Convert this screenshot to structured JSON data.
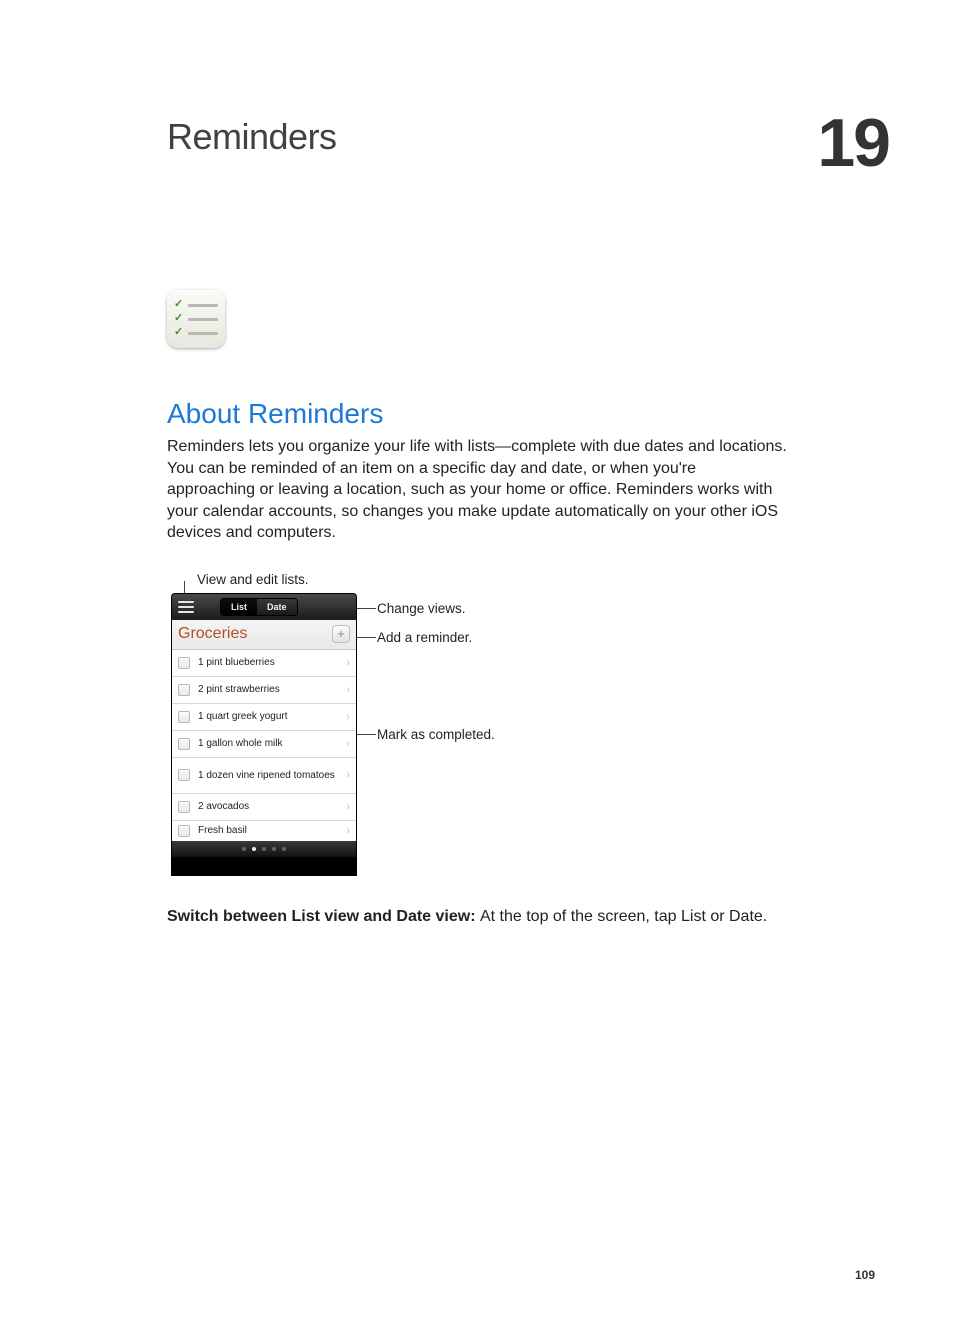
{
  "chapter": {
    "title": "Reminders",
    "number": "19"
  },
  "section": {
    "heading": "About Reminders",
    "body": "Reminders lets you organize your life with lists—complete with due dates and locations. You can be reminded of an item on a specific day and date, or when you're approaching or leaving a location, such as your home or office. Reminders works with your calendar accounts, so changes you make update automatically on your other iOS devices and computers."
  },
  "callouts": {
    "viewEdit": "View and edit lists.",
    "changeViews": "Change views.",
    "addReminder": "Add a reminder.",
    "markCompleted": "Mark as completed."
  },
  "phone": {
    "segmented": {
      "list": "List",
      "date": "Date"
    },
    "listTitle": "Groceries",
    "addGlyph": "+",
    "items": [
      "1 pint blueberries",
      "2 pint strawberries",
      "1 quart greek yogurt",
      "1 gallon whole milk",
      "1 dozen vine ripened tomatoes",
      "2 avocados",
      "Fresh basil"
    ]
  },
  "caption": {
    "bold": "Switch between List view and Date view:  ",
    "rest": "At the top of the screen, tap List or Date."
  },
  "pageNumber": "109"
}
